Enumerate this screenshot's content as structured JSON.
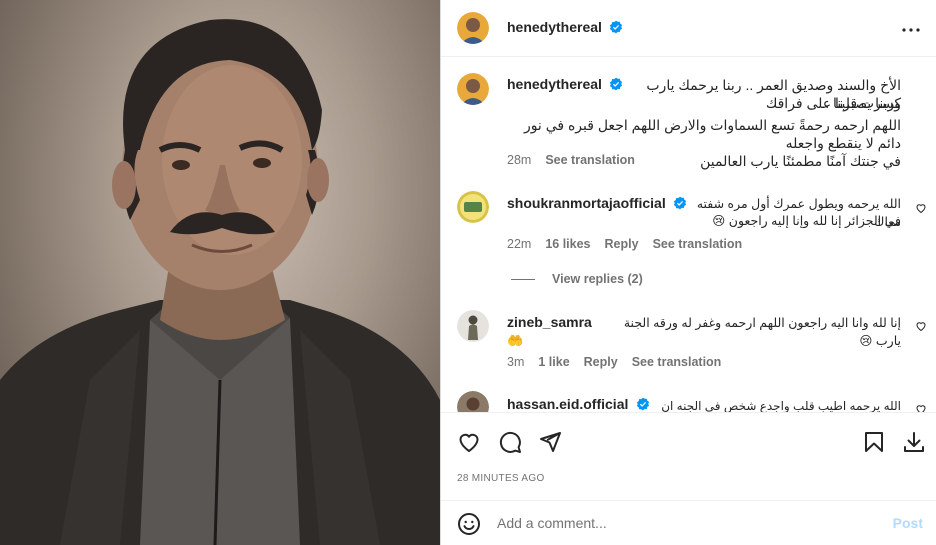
{
  "post": {
    "author": "henedythereal",
    "time_ago": "28 MINUTES AGO"
  },
  "caption": {
    "username": "henedythereal",
    "line1": "الأخ والسند وصديق العمر .. ربنا يرحمك يارب كسرت قلبنا ..",
    "line2": "وربنا يصبرنا على فراقك",
    "line3": "اللهم ارحمه رحمةً تسع السماوات والارض اللهم اجعل قبره في نور دائم لا ينقطع واجعله",
    "line4": "في جنتك آمنًا مطمئنًا يارب العالمين",
    "time": "28m",
    "see_translation": "See translation"
  },
  "comments": [
    {
      "username": "shoukranmortajaofficial",
      "verified": true,
      "line1": "الله يرحمه ويطول عمرك أول مره شفته معاك",
      "line2": "في الجزائر إنا لله وإنا إليه راجعون 😢",
      "time": "22m",
      "likes": "16 likes",
      "reply": "Reply",
      "see_translation": "See translation",
      "view_replies": "View replies (2)"
    },
    {
      "username": "zineb_samra",
      "verified": false,
      "line1": "إنا لله وانا اليه راجعون اللهم ارحمه وغفر له ورقه الجنة يارب 😢",
      "line2": "🤲",
      "time": "3m",
      "likes": "1 like",
      "reply": "Reply",
      "see_translation": "See translation"
    },
    {
      "username": "hassan.eid.official",
      "verified": true,
      "line1": "الله يرحمه اطيب قلب واجدع شخص فى الجنه ان شاء"
    }
  ],
  "actions": {
    "like_icon": "heart-icon",
    "comment_icon": "comment-icon",
    "share_icon": "share-icon",
    "save_icon": "bookmark-icon",
    "download_icon": "download-icon"
  },
  "add_comment": {
    "placeholder": "Add a comment...",
    "post_label": "Post"
  },
  "colors": {
    "verified": "#0095f6",
    "muted": "#737373",
    "post_disabled": "#b3dbff"
  }
}
